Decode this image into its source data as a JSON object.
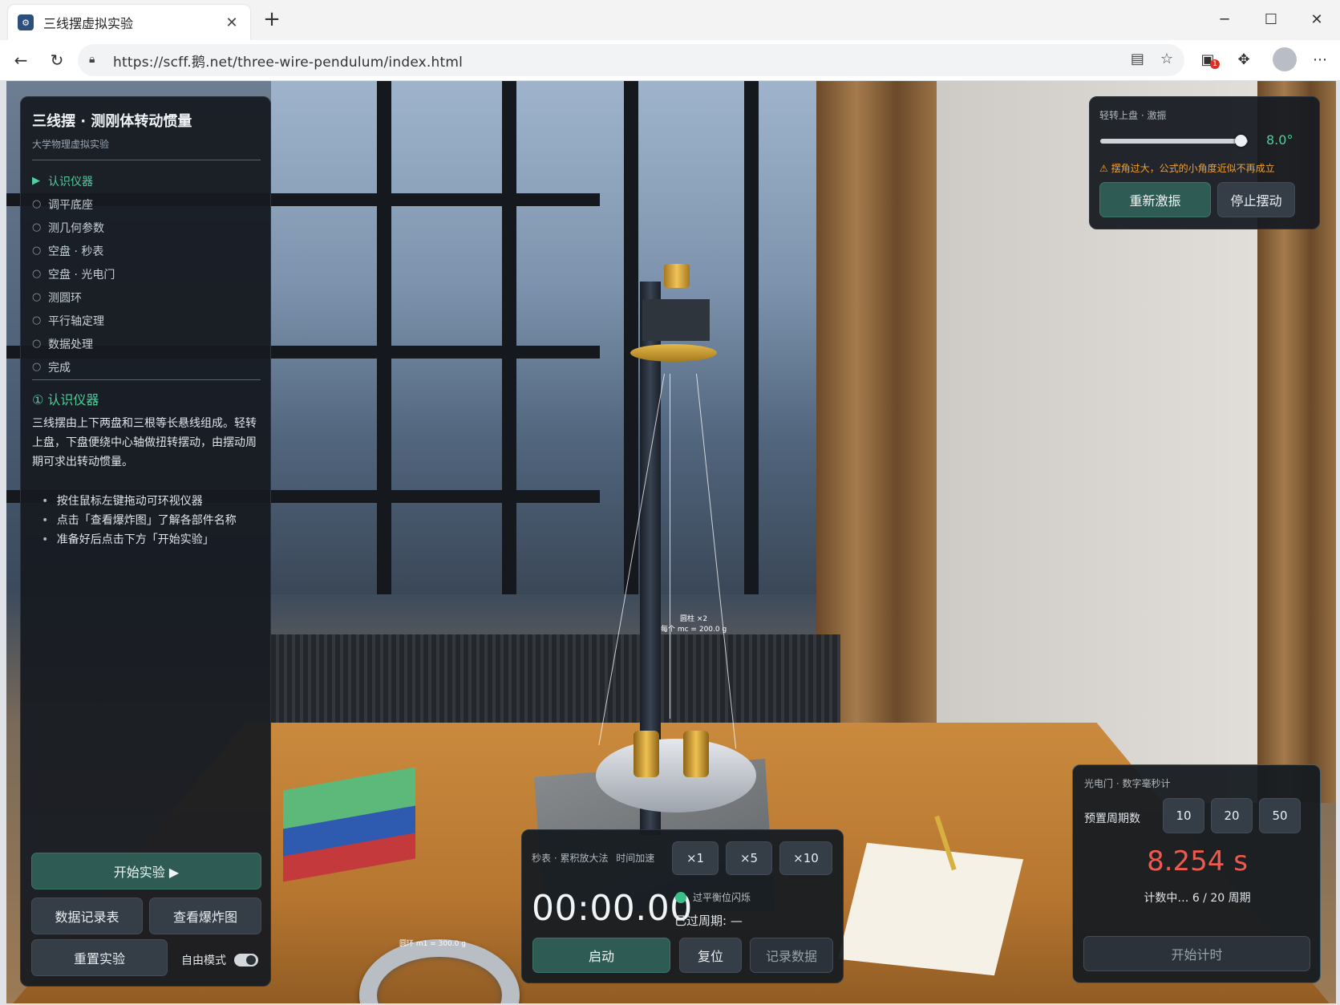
{
  "browser": {
    "tab_title": "三线摆虚拟实验",
    "url": "https://scff.鹅.net/three-wire-pendulum/index.html",
    "extension_badge": "1"
  },
  "left_panel": {
    "title": "三线摆 · 测刚体转动惯量",
    "subtitle": "大学物理虚拟实验",
    "steps": [
      {
        "label": "认识仪器",
        "active": true
      },
      {
        "label": "调平底座",
        "active": false
      },
      {
        "label": "测几何参数",
        "active": false
      },
      {
        "label": "空盘 · 秒表",
        "active": false
      },
      {
        "label": "空盘 · 光电门",
        "active": false
      },
      {
        "label": "测圆环",
        "active": false
      },
      {
        "label": "平行轴定理",
        "active": false
      },
      {
        "label": "数据处理",
        "active": false
      },
      {
        "label": "完成",
        "active": false
      }
    ],
    "active_marker": "▶",
    "inactive_marker": "○",
    "section_heading": "① 认识仪器",
    "description": "三线摆由上下两盘和三根等长悬线组成。轻转上盘，下盘便绕中心轴做扭转摆动，由摆动周期可求出转动惯量。",
    "bullets": [
      "按住鼠标左键拖动可环视仪器",
      "点击「查看爆炸图」了解各部件名称",
      "准备好后点击下方「开始实验」"
    ],
    "start_button": "开始实验 ▶",
    "data_table_button": "数据记录表",
    "exploded_view_button": "查看爆炸图",
    "reset_button": "重置实验",
    "free_mode_label": "自由模式",
    "free_mode_on": true
  },
  "excite_panel": {
    "label": "轻转上盘 · 激振",
    "angle_value": "8.0°",
    "angle_fraction": 0.95,
    "warning": "⚠ 摆角过大，公式的小角度近似不再成立",
    "re_excite_button": "重新激振",
    "stop_button": "停止摆动"
  },
  "stopwatch_panel": {
    "label": "秒表 · 累积放大法",
    "speed_label": "时间加速",
    "speed_options": [
      "×1",
      "×5",
      "×10"
    ],
    "time": "00:00.00",
    "flash_label": "过平衡位闪烁",
    "cycles_label": "已过周期: —",
    "start_button": "启动",
    "reset_button": "复位",
    "record_button": "记录数据"
  },
  "photogate_panel": {
    "label": "光电门 · 数字毫秒计",
    "preset_label": "预置周期数",
    "preset_options": [
      "10",
      "20",
      "50"
    ],
    "time": "8.254 s",
    "status": "计数中… 6 / 20 周期",
    "start_button": "开始计时"
  },
  "scene_labels": {
    "cylinders": "圆柱 ×2",
    "cylinders_mass": "每个 mc = 200.0 g",
    "ring": "圆环 m1 = 300.0 g"
  },
  "colors": {
    "accent_green": "#4ecf9c",
    "warning_orange": "#f0a232",
    "timer_red": "#ef5a50",
    "panel_bg": "#161b21"
  }
}
